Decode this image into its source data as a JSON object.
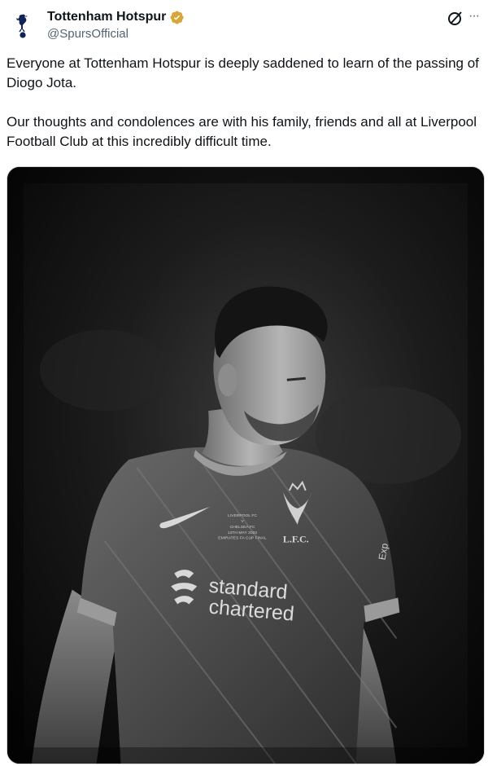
{
  "author": {
    "display_name": "Tottenham Hotspur",
    "handle": "@SpursOfficial",
    "avatar_icon": "cockerel-logo-icon",
    "verified_badge_color": "#d6a63a"
  },
  "actions": {
    "grok_icon": "grok-icon",
    "more_icon": "more-icon",
    "more_label": "···"
  },
  "tweet": {
    "paragraph_1": "Everyone at Tottenham Hotspur is deeply saddened to learn of the passing of Diogo Jota.",
    "paragraph_2": "Our thoughts and condolences are with his family, friends and all at Liverpool Football Club at this incredibly difficult time."
  },
  "media": {
    "style": "black-and-white photo",
    "shirt_sponsor_line1": "standard",
    "shirt_sponsor_line2": "chartered",
    "shirt_badge_text": "L.F.C.",
    "shirt_commemoration": [
      "LIVERPOOL FC",
      "V",
      "CHELSEA FC",
      "14TH MAY 2022",
      "EMIRATES FA CUP FINAL"
    ],
    "sleeve_text": "Exp"
  },
  "colors": {
    "text": "#0f1419",
    "secondary": "#536471",
    "border": "#cfd9de"
  }
}
